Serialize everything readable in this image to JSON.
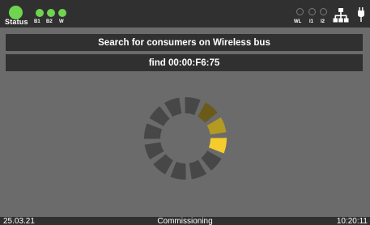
{
  "status": {
    "label": "Status",
    "color": "#6fd54f",
    "leds": [
      {
        "label": "B1",
        "color": "#6fd54f"
      },
      {
        "label": "B2",
        "color": "#6fd54f"
      },
      {
        "label": "W",
        "color": "#6fd54f"
      }
    ]
  },
  "indicators": [
    {
      "label": "WL",
      "state": "off"
    },
    {
      "label": "I1",
      "state": "off"
    },
    {
      "label": "I2",
      "state": "off"
    }
  ],
  "icons": {
    "network": "network-icon",
    "plug": "plug-icon"
  },
  "banners": {
    "search_message": "Search for consumers on Wireless bus",
    "find_message": "find 00:00:F6:75"
  },
  "spinner": {
    "segments": 12,
    "dark_color": "#474747",
    "highlight_colors": [
      "#6a5b1b",
      "#b39a22",
      "#f5cc2b"
    ]
  },
  "footer": {
    "date": "25.03.21",
    "mode": "Commissioning",
    "time": "10:20:11"
  }
}
